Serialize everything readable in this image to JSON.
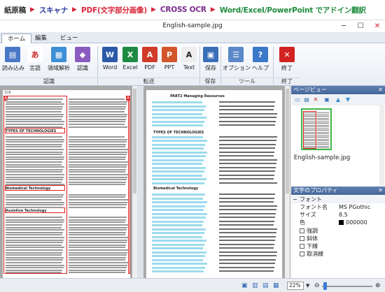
{
  "workflow": [
    {
      "label": "紙原稿",
      "color": "#333333"
    },
    {
      "label": "スキャナ",
      "color": "#2a3a9c"
    },
    {
      "label": "PDF(文字部分画像)",
      "color": "#d8263a"
    },
    {
      "label": "CROSS OCR",
      "color": "#7a2a8c"
    },
    {
      "label": "Word/Excel/PowerPoint でアドイン翻訳",
      "color": "#1e8a3c"
    }
  ],
  "window": {
    "title": "English-sample.jpg"
  },
  "tabs": [
    {
      "label": "ホーム"
    },
    {
      "label": "編集"
    },
    {
      "label": "ビュー"
    }
  ],
  "ribbon": {
    "buttons": [
      {
        "label": "読み込み",
        "icon": "scanner-icon",
        "glyph": "▤",
        "bg": "#4a78c8"
      },
      {
        "label": "言語",
        "icon": "language-icon",
        "glyph": "あ",
        "bg": "#ffffff",
        "fg": "#cc2222"
      },
      {
        "label": "領域解析",
        "icon": "layout-analysis-icon",
        "glyph": "▦",
        "bg": "#3d8fd6"
      },
      {
        "label": "認識",
        "icon": "recognize-icon",
        "glyph": "◆",
        "bg": "#8a5cc0"
      },
      {
        "label": "Word",
        "icon": "word-icon",
        "glyph": "W",
        "bg": "#2b5aa8"
      },
      {
        "label": "Excel",
        "icon": "excel-icon",
        "glyph": "X",
        "bg": "#1f8a42"
      },
      {
        "label": "PDF",
        "icon": "pdf-icon",
        "glyph": "A",
        "bg": "#d23a2a"
      },
      {
        "label": "PPT",
        "icon": "ppt-icon",
        "glyph": "P",
        "bg": "#d2562a"
      },
      {
        "label": "Text",
        "icon": "text-icon",
        "glyph": "A",
        "bg": "#eeeeee",
        "fg": "#222222"
      },
      {
        "label": "保存",
        "icon": "save-icon",
        "glyph": "▣",
        "bg": "#3a6fb8"
      },
      {
        "label": "オプション",
        "icon": "options-icon",
        "glyph": "☰",
        "bg": "#5a88c8"
      },
      {
        "label": "ヘルプ",
        "icon": "help-icon",
        "glyph": "?",
        "bg": "#3a78c8"
      },
      {
        "label": "終了",
        "icon": "exit-icon",
        "glyph": "✕",
        "bg": "#d22222"
      }
    ],
    "groups": [
      {
        "label": "認識"
      },
      {
        "label": "転送"
      },
      {
        "label": "保存"
      },
      {
        "label": "ツール"
      },
      {
        "label": "終了"
      }
    ]
  },
  "left_page": {
    "page_number": "108",
    "section_titles": [
      "TYPES OF TECHNOLOGIES",
      "Biomedical Technology",
      "Assistive Technology"
    ],
    "region_label": "A"
  },
  "right_page": {
    "heading": "PART2 Managing Resources",
    "section_titles": [
      "TYPES OF TECHNOLOGIES",
      "Biomedical Technology"
    ]
  },
  "page_view": {
    "title": "ページビュー",
    "thumbnail_caption": "English-sample.jpg"
  },
  "properties": {
    "title": "文字のプロパティ",
    "section": "フォント",
    "rows": [
      {
        "key": "フォント名",
        "value": "MS PGothic"
      },
      {
        "key": "サイズ",
        "value": "8.5"
      },
      {
        "key": "色",
        "value": "000000"
      }
    ],
    "checkboxes": [
      {
        "label": "強調"
      },
      {
        "label": "斜体"
      },
      {
        "label": "下線"
      },
      {
        "label": "取消線"
      }
    ]
  },
  "status": {
    "zoom": "22%"
  }
}
